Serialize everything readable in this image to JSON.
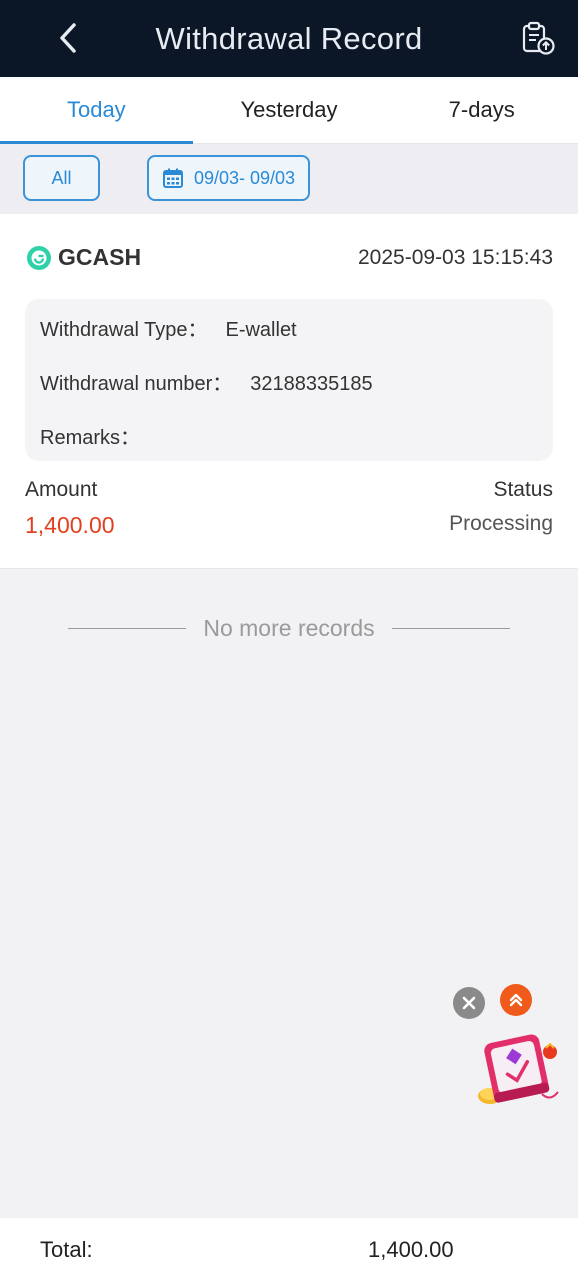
{
  "header": {
    "title": "Withdrawal Record",
    "back_icon": "chevron-left-icon",
    "action_icon": "clipboard-upload-icon"
  },
  "tabs": [
    {
      "label": "Today",
      "active": true
    },
    {
      "label": "Yesterday",
      "active": false
    },
    {
      "label": "7-days",
      "active": false
    }
  ],
  "filters": {
    "all_label": "All",
    "date_range": "09/03- 09/03",
    "date_icon": "calendar-icon"
  },
  "record": {
    "method": "GCASH",
    "method_icon": "gcash-logo-icon",
    "datetime": "2025-09-03 15:15:43",
    "type_label": "Withdrawal Type：",
    "type_value": "E-wallet",
    "number_label": "Withdrawal number：",
    "number_value": "32188335185",
    "remarks_label": "Remarks：",
    "remarks_value": "",
    "amount_label": "Amount",
    "amount_value": "1,400.00",
    "status_label": "Status",
    "status_value": "Processing"
  },
  "list_end_text": "No more records",
  "footer": {
    "total_label": "Total:",
    "total_value": "1,400.00"
  },
  "colors": {
    "header_bg": "#0b1626",
    "accent_blue": "#2a8ad6",
    "amount_red": "#e3401f",
    "gcash_green": "#2ed1a8"
  }
}
